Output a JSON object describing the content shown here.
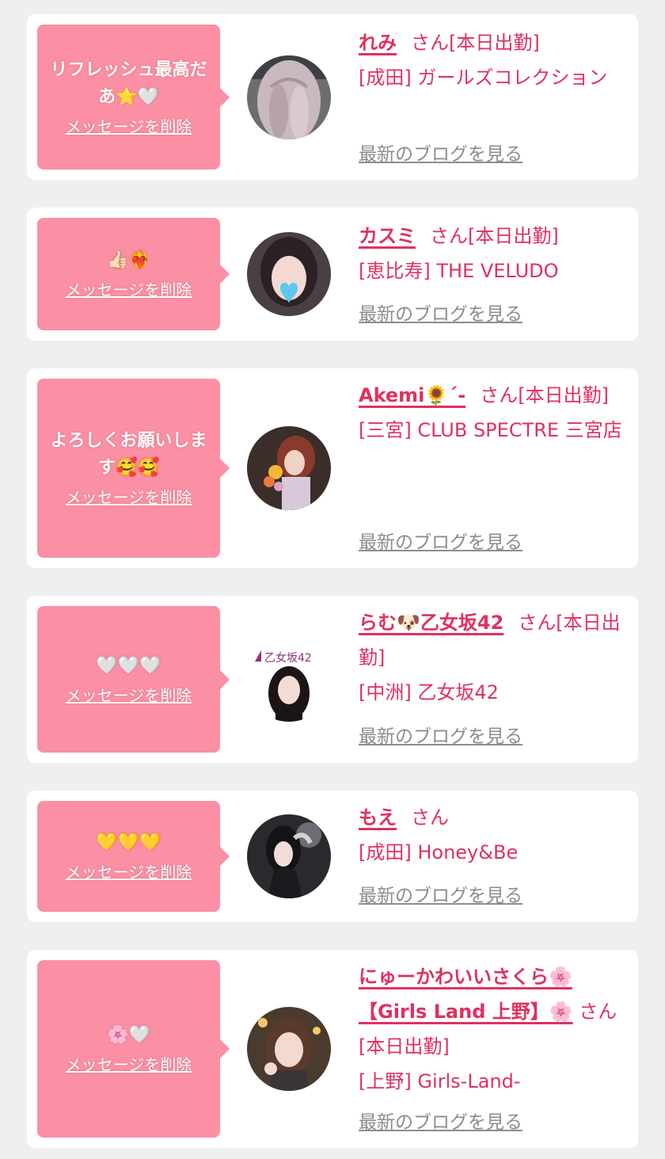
{
  "labels": {
    "delete": "メッセージを削除",
    "blog": "最新のブログを見る",
    "san": "さん"
  },
  "colors": {
    "background": "#efefef",
    "bubble": "#fb8fa3",
    "name_text": "#e0315e",
    "blog_link": "#8c8c8c"
  },
  "entries": [
    {
      "message": "リフレッシュ最高だあ⭐🤍",
      "name": "れみ",
      "status": "[本日出勤]",
      "shop": "[成田] ガールズコレクション"
    },
    {
      "message": "👍🏻❤️‍🔥",
      "name": "カスミ",
      "status": "[本日出勤]",
      "shop": "[恵比寿] THE VELUDO"
    },
    {
      "message": "よろしくお願いします🥰🥰",
      "name": "Akemi🌻´-",
      "status": "[本日出勤]",
      "shop": "[三宮] CLUB SPECTRE 三宮店"
    },
    {
      "message": "🤍🤍🤍",
      "name": "らむ🐶乙女坂42",
      "status": "[本日出勤]",
      "shop": "[中洲] 乙女坂42",
      "avatar_overlay_text": "乙女坂42"
    },
    {
      "message": "💛💛💛",
      "name": "もえ",
      "status": "",
      "shop": "[成田] Honey&Be"
    },
    {
      "message": "🌸🤍",
      "name": "にゅーかわいいさくら🌸【Girls Land 上野】🌸",
      "status": "[本日出勤]",
      "shop": "[上野] Girls-Land-"
    }
  ]
}
